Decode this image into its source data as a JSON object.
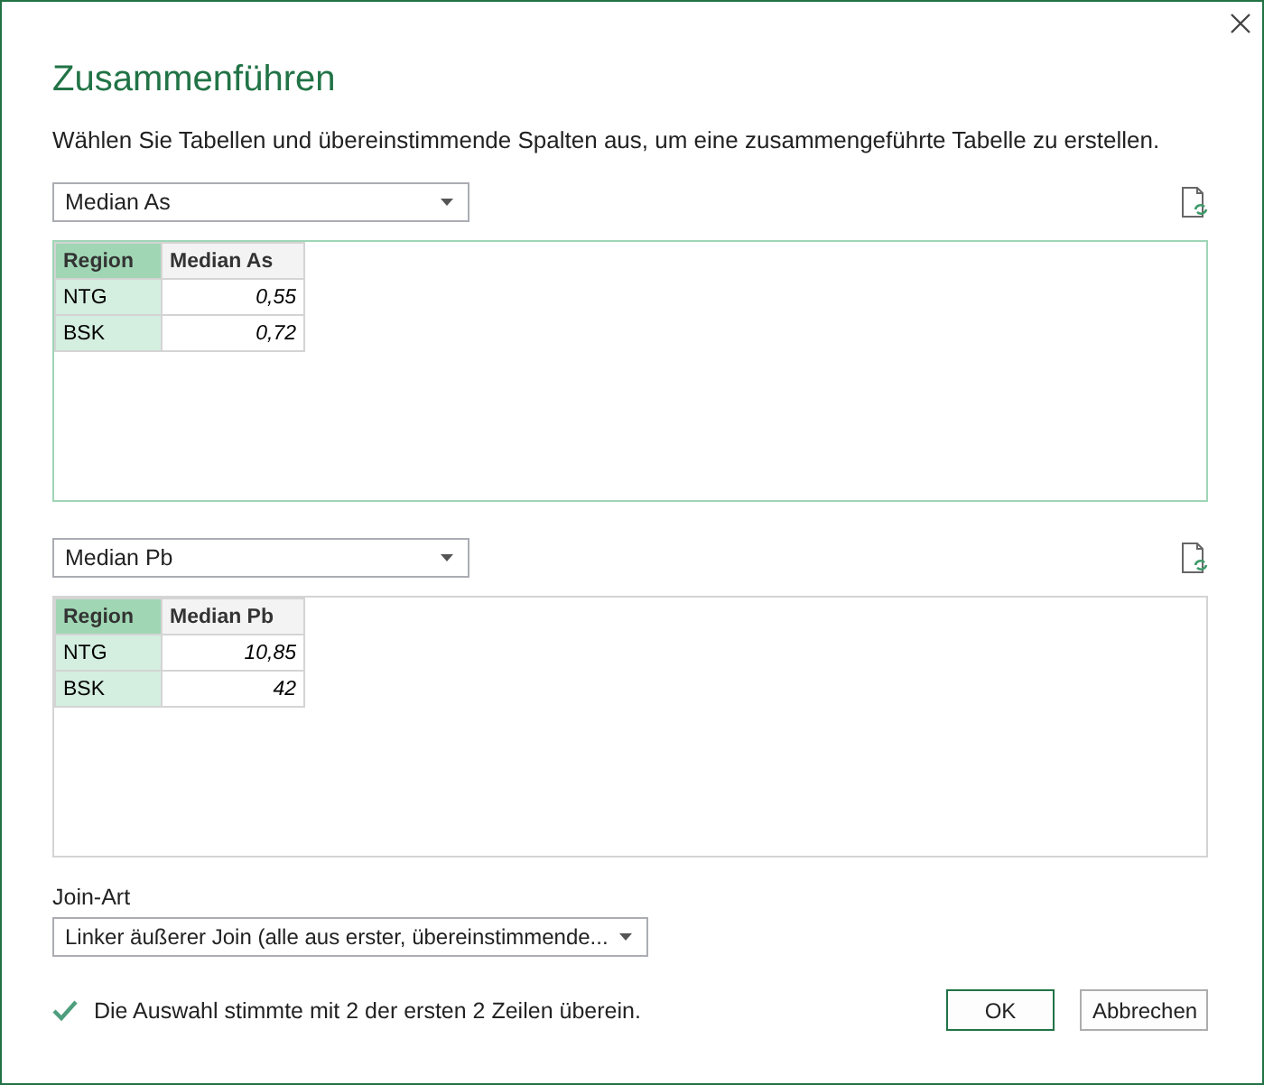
{
  "window": {
    "title": "Zusammenführen"
  },
  "description": "Wählen Sie Tabellen und übereinstimmende Spalten aus, um eine zusammengeführte Tabelle zu erstellen.",
  "tables": [
    {
      "dropdown": "Median As",
      "selected": true,
      "columns": [
        {
          "name": "Region",
          "selected": true
        },
        {
          "name": "Median As",
          "selected": false
        }
      ],
      "rows": [
        [
          "NTG",
          "0,55"
        ],
        [
          "BSK",
          "0,72"
        ]
      ]
    },
    {
      "dropdown": "Median Pb",
      "selected": false,
      "columns": [
        {
          "name": "Region",
          "selected": true
        },
        {
          "name": "Median Pb",
          "selected": false
        }
      ],
      "rows": [
        [
          "NTG",
          "10,85"
        ],
        [
          "BSK",
          "42"
        ]
      ]
    }
  ],
  "join": {
    "label": "Join-Art",
    "value": "Linker äußerer Join (alle aus erster, übereinstimmende..."
  },
  "status": {
    "ok": true,
    "text": "Die Auswahl stimmte mit 2 der ersten 2 Zeilen überein."
  },
  "buttons": [
    {
      "label": "OK",
      "primary": true
    },
    {
      "label": "Abbrechen",
      "primary": false
    }
  ]
}
